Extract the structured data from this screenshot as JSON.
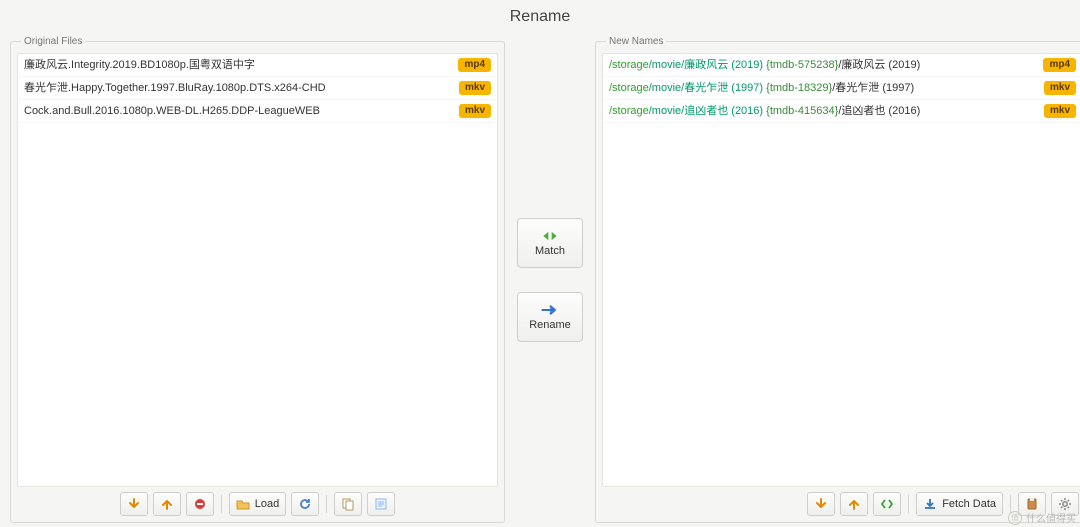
{
  "window": {
    "title": "Rename"
  },
  "panels": {
    "original": {
      "legend": "Original Files"
    },
    "newnames": {
      "legend": "New Names"
    }
  },
  "buttons": {
    "match": "Match",
    "rename": "Rename",
    "load": "Load",
    "fetch": "Fetch Data"
  },
  "original_files": [
    {
      "name": "廉政风云.Integrity.2019.BD1080p.国粤双语中字",
      "ext": "mp4"
    },
    {
      "name": "春光乍泄.Happy.Together.1997.BluRay.1080p.DTS.x264-CHD",
      "ext": "mkv"
    },
    {
      "name": "Cock.and.Bull.2016.1080p.WEB-DL.H265.DDP-LeagueWEB",
      "ext": "mkv"
    }
  ],
  "new_names": [
    {
      "storage": "/storage",
      "root": "/movie/",
      "folder": "廉政风云 (2019)",
      "tmdb": "{tmdb-575238}",
      "title": "廉政风云 (2019)",
      "ext": "mp4"
    },
    {
      "storage": "/storage",
      "root": "/movie/",
      "folder": "春光乍泄 (1997)",
      "tmdb": "{tmdb-18329}",
      "title": "春光乍泄 (1997)",
      "ext": "mkv"
    },
    {
      "storage": "/storage",
      "root": "/movie/",
      "folder": "追凶者也 (2016)",
      "tmdb": "{tmdb-415634}",
      "title": "追凶者也 (2016)",
      "ext": "mkv"
    }
  ],
  "watermark": "什么值得买"
}
